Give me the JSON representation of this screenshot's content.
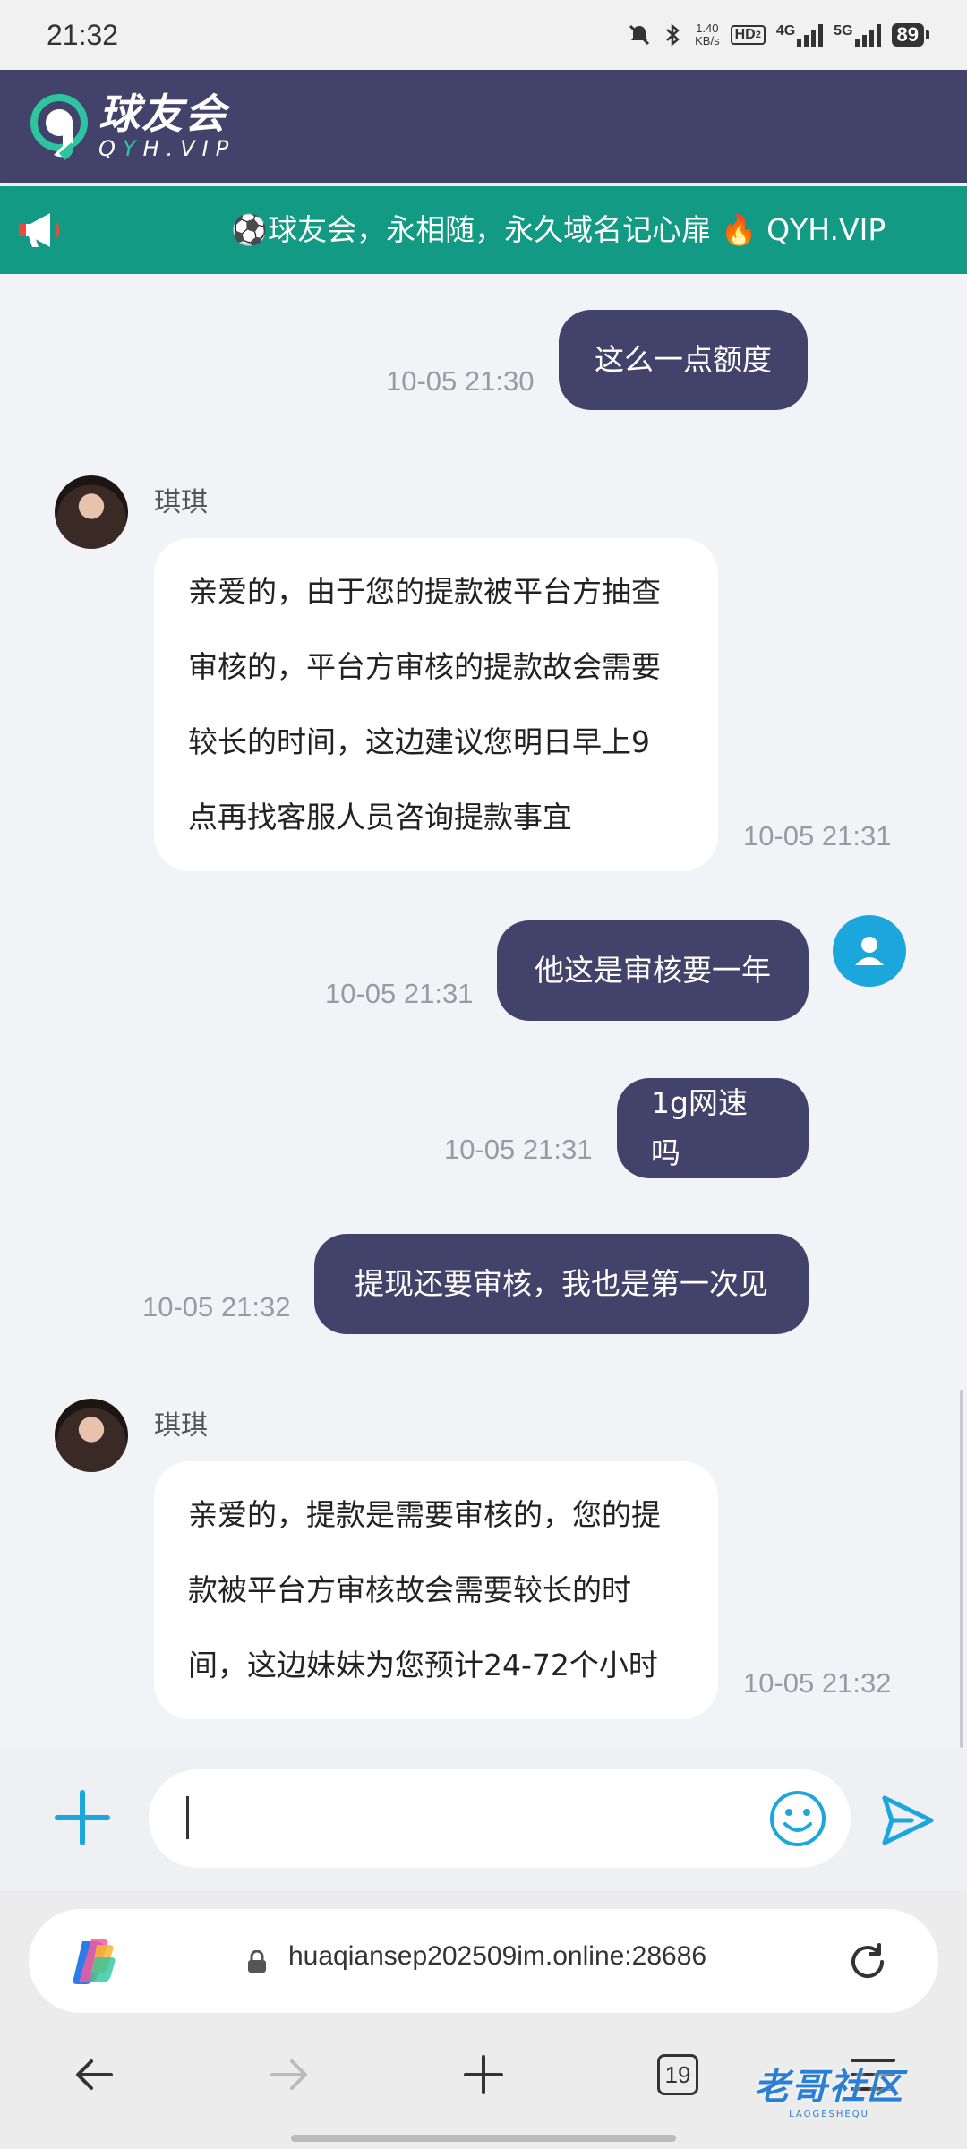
{
  "status_bar": {
    "time": "21:32",
    "net_speed_value": "1.40",
    "net_speed_unit": "KB/s",
    "hd_label": "HD",
    "hd_sub": "2",
    "net1_label": "4G",
    "net2_label": "5G",
    "battery": "89"
  },
  "header": {
    "logo_name": "球友会",
    "logo_domain_q": "Q",
    "logo_domain_y": "Y",
    "logo_domain_rest": "H.VIP"
  },
  "notice": {
    "text": "⚽球友会，永相随，永久域名记心扉 🔥 QYH.VIP"
  },
  "messages": [
    {
      "text": "这么一点额度",
      "time": "10-05 21:30"
    },
    {
      "sender": "琪琪",
      "lines": [
        "亲爱的，由于您的提款被平台方抽查",
        "审核的，平台方审核的提款故会需要",
        "较长的时间，这边建议您明日早上9",
        "点再找客服人员咨询提款事宜"
      ],
      "time": "10-05 21:31"
    },
    {
      "text": "他这是审核要一年",
      "time": "10-05 21:31"
    },
    {
      "text": "1g网速吗",
      "time": "10-05 21:31"
    },
    {
      "text": "提现还要审核，我也是第一次见",
      "time": "10-05 21:32"
    },
    {
      "sender": "琪琪",
      "lines": [
        "亲爱的，提款是需要审核的，您的提",
        "款被平台方审核故会需要较长的时",
        "间，这边妹妹为您预计24-72个小时"
      ],
      "time": "10-05 21:32"
    }
  ],
  "composer": {
    "input_value": "",
    "input_placeholder": ""
  },
  "browser": {
    "url": "huaqiansep202509im.online:28686",
    "tab_count": "19"
  },
  "watermark": {
    "main": "老哥社区",
    "sub": "LAOGESHEQU"
  },
  "colors": {
    "header_bg": "#43426b",
    "notice_bg": "#129a84",
    "outgoing_bubble": "#43426b",
    "accent_blue": "#1ba7dc"
  }
}
